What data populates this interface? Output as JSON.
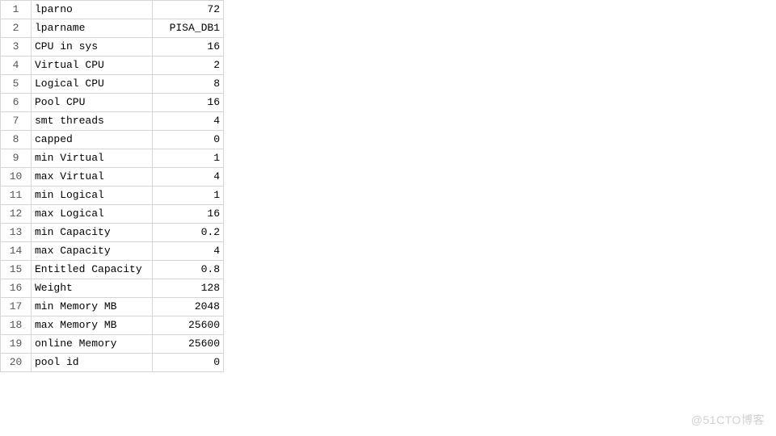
{
  "rows": [
    {
      "n": "1",
      "key": "lparno",
      "value": "72"
    },
    {
      "n": "2",
      "key": "lparname",
      "value": "PISA_DB1"
    },
    {
      "n": "3",
      "key": "CPU in sys",
      "value": "16"
    },
    {
      "n": "4",
      "key": "Virtual CPU",
      "value": "2"
    },
    {
      "n": "5",
      "key": "Logical CPU",
      "value": "8"
    },
    {
      "n": "6",
      "key": "Pool CPU",
      "value": "16"
    },
    {
      "n": "7",
      "key": "smt threads",
      "value": "4"
    },
    {
      "n": "8",
      "key": "capped",
      "value": "0"
    },
    {
      "n": "9",
      "key": "min Virtual",
      "value": "1"
    },
    {
      "n": "10",
      "key": "max Virtual",
      "value": "4"
    },
    {
      "n": "11",
      "key": "min Logical",
      "value": "1"
    },
    {
      "n": "12",
      "key": "max Logical",
      "value": "16"
    },
    {
      "n": "13",
      "key": "min Capacity",
      "value": "0.2"
    },
    {
      "n": "14",
      "key": "max Capacity",
      "value": "4"
    },
    {
      "n": "15",
      "key": "Entitled Capacity",
      "value": "0.8"
    },
    {
      "n": "16",
      "key": "Weight",
      "value": "128"
    },
    {
      "n": "17",
      "key": "min Memory MB",
      "value": "2048"
    },
    {
      "n": "18",
      "key": "max Memory MB",
      "value": "25600"
    },
    {
      "n": "19",
      "key": "online Memory",
      "value": "25600"
    },
    {
      "n": "20",
      "key": "pool id",
      "value": "0"
    }
  ],
  "watermark": "@51CTO博客"
}
